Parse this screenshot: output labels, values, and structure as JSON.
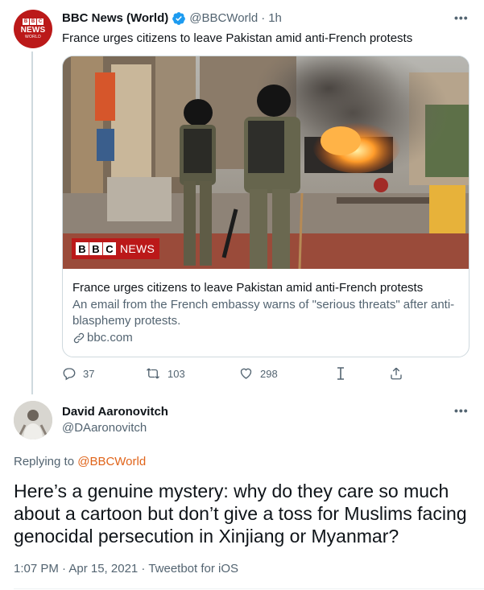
{
  "tweet1": {
    "avatar": {
      "top": "BBC",
      "middle": "NEWS",
      "bottom": "WORLD"
    },
    "display_name": "BBC News (World)",
    "handle": "@BBCWorld",
    "separator": "·",
    "time": "1h",
    "text": "France urges citizens to leave Pakistan amid anti-French protests",
    "card": {
      "image_badge": {
        "blocks": [
          "B",
          "B",
          "C"
        ],
        "word": "NEWS"
      },
      "title": "France urges citizens to leave Pakistan amid anti-French protests",
      "description": "An email from the French embassy warns of \"serious threats\" after anti-blasphemy protests.",
      "domain": "bbc.com"
    },
    "actions": {
      "replies": "37",
      "retweets": "103",
      "likes": "298"
    }
  },
  "tweet2": {
    "display_name": "David Aaronovitch",
    "handle": "@DAaronovitch",
    "replying_prefix": "Replying to ",
    "replying_to": "@BBCWorld",
    "text": "Here’s a genuine mystery: why do they care so much about a cartoon but don’t give a toss for Muslims facing genocidal persecution in Xinjiang or Myanmar?",
    "meta": "1:07 PM · Apr 15, 2021 · Tweetbot for iOS"
  },
  "icons": {
    "verified": "verified-badge-icon",
    "more": "more-horizontal-icon",
    "reply": "reply-icon",
    "retweet": "retweet-icon",
    "like": "heart-icon",
    "tweetbot": "tweetbot-icon",
    "share": "share-icon",
    "link": "link-icon"
  },
  "colors": {
    "verified": "#1d9bf0",
    "bbc_red": "#bb1919",
    "mention": "#e0641a",
    "muted": "#536471"
  }
}
